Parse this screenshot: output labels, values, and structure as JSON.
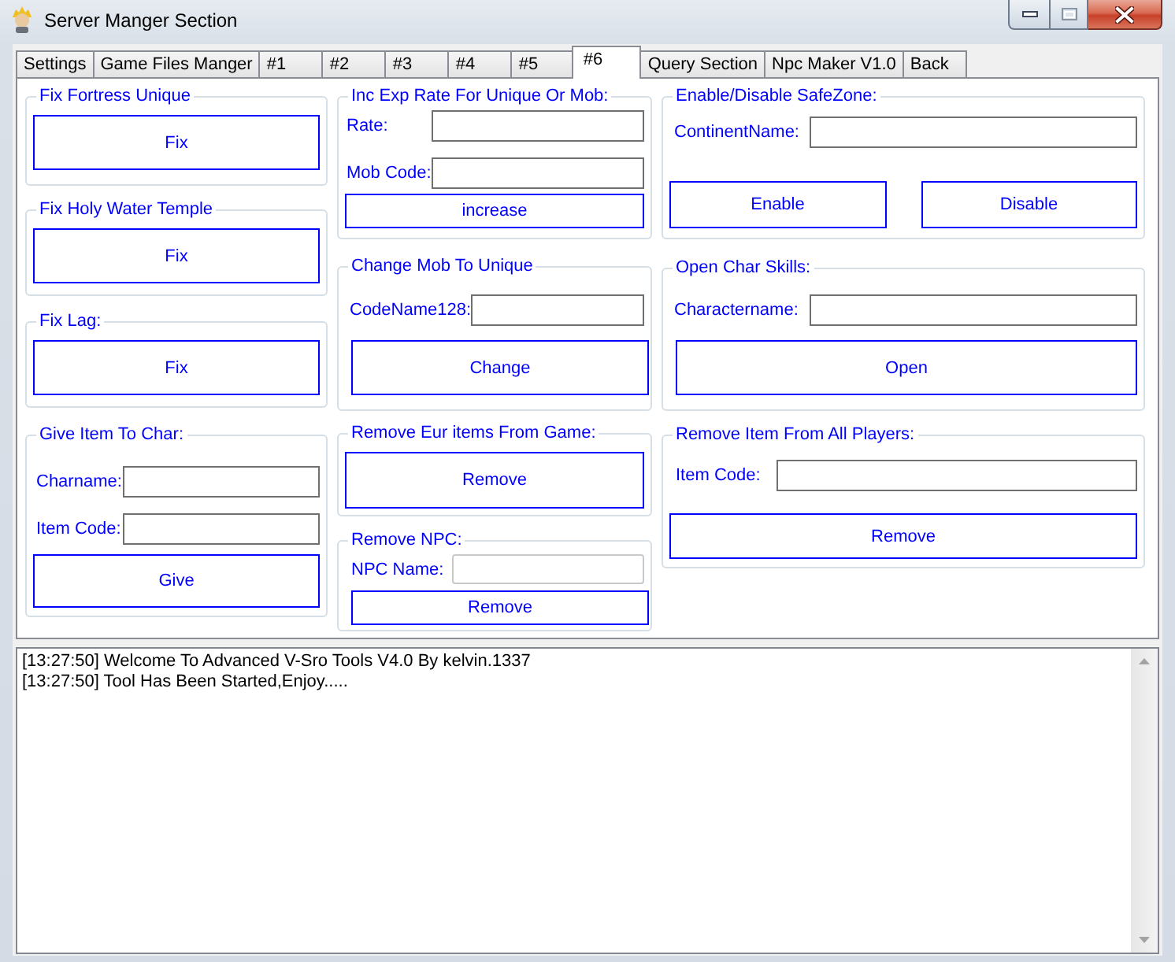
{
  "window": {
    "title": "Server Manger Section"
  },
  "tabs": [
    {
      "label": "Settings",
      "selected": false
    },
    {
      "label": "Game Files Manger",
      "selected": false
    },
    {
      "label": "#1",
      "selected": false
    },
    {
      "label": "#2",
      "selected": false
    },
    {
      "label": "#3",
      "selected": false
    },
    {
      "label": "#4",
      "selected": false
    },
    {
      "label": "#5",
      "selected": false
    },
    {
      "label": "#6",
      "selected": true
    },
    {
      "label": "Query Section",
      "selected": false
    },
    {
      "label": "Npc Maker V1.0",
      "selected": false
    },
    {
      "label": "Back",
      "selected": false
    }
  ],
  "columns": [
    {
      "groups": [
        {
          "title": "Fix Fortress Unique",
          "items": [
            {
              "kind": "button",
              "label": "Fix"
            }
          ]
        },
        {
          "title": "Fix Holy Water Temple",
          "items": [
            {
              "kind": "button",
              "label": "Fix"
            }
          ]
        },
        {
          "title": "Fix Lag:",
          "items": [
            {
              "kind": "button",
              "label": "Fix"
            }
          ]
        },
        {
          "title": "Give Item To Char:",
          "items": [
            {
              "kind": "field",
              "label": "Charname:"
            },
            {
              "kind": "field",
              "label": "Item Code:"
            },
            {
              "kind": "button",
              "label": "Give"
            }
          ]
        }
      ]
    },
    {
      "groups": [
        {
          "title": "Inc Exp Rate For Unique Or Mob:",
          "items": [
            {
              "kind": "field",
              "label": "Rate:"
            },
            {
              "kind": "field",
              "label": "Mob Code:"
            },
            {
              "kind": "button",
              "label": "increase"
            }
          ]
        },
        {
          "title": "Change Mob To Unique",
          "items": [
            {
              "kind": "field",
              "label": "CodeName128:"
            },
            {
              "kind": "button",
              "label": "Change"
            }
          ]
        },
        {
          "title": "Remove Eur items From Game:",
          "items": [
            {
              "kind": "button",
              "label": "Remove"
            }
          ]
        },
        {
          "title": "Remove NPC:",
          "items": [
            {
              "kind": "field",
              "label": "NPC Name:"
            },
            {
              "kind": "button",
              "label": "Remove"
            }
          ]
        }
      ]
    },
    {
      "groups": [
        {
          "title": "Enable/Disable SafeZone:",
          "items": [
            {
              "kind": "field",
              "label": "ContinentName:"
            },
            {
              "kind": "buttons",
              "buttons": [
                "Enable",
                "Disable"
              ]
            }
          ]
        },
        {
          "title": "Open Char Skills:",
          "items": [
            {
              "kind": "field",
              "label": "Charactername:"
            },
            {
              "kind": "button",
              "label": "Open"
            }
          ]
        },
        {
          "title": "Remove Item From All Players:",
          "items": [
            {
              "kind": "field",
              "label": "Item Code:"
            },
            {
              "kind": "button",
              "label": "Remove"
            }
          ]
        }
      ]
    }
  ],
  "log": {
    "lines": [
      "[13:27:50] Welcome To Advanced V-Sro Tools V4.0 By kelvin.1337",
      "[13:27:50] Tool Has Been Started,Enjoy....."
    ]
  }
}
